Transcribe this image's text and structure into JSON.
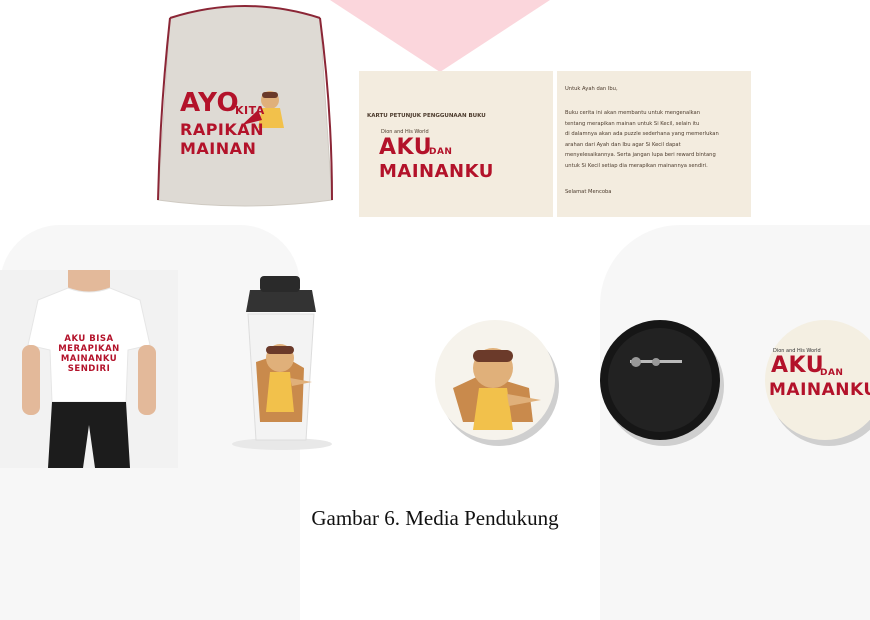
{
  "bag": {
    "line1": "AYO",
    "line1b": "KITA",
    "line2": "RAPIKAN MAINAN"
  },
  "card_left": {
    "heading": "KARTU PETUNJUK PENGGUNAAN BUKU",
    "series": "Dion and His World",
    "title1": "AKU",
    "title_dan": "DAN",
    "title2": "MAINANKU"
  },
  "card_right": {
    "greeting": "Untuk Ayah dan Ibu,",
    "body": [
      "Buku cerita ini akan membantu untuk mengenalkan",
      "tentang merapikan mainan untuk Si Kecil, selain itu",
      "di dalamnya akan ada puzzle sederhana yang memerlukan",
      "arahan dari Ayah dan Ibu agar Si Kecil dapat",
      "menyelesaikannya. Serta jangan lupa beri reward bintang",
      "untuk Si Kecil setiap dia merapikan mainannya sendiri."
    ],
    "closing": "Selamat Mencoba"
  },
  "tshirt": {
    "lines": [
      "AKU BISA",
      "MERAPIKAN",
      "MAINANKU",
      "SENDIRI"
    ]
  },
  "button": {
    "series": "Dion and His World",
    "title1": "AKU",
    "title_dan": "DAN",
    "title2": "MAINANKU"
  },
  "caption": "Gambar 6. Media Pendukung",
  "colors": {
    "brand_red": "#b3122a",
    "card_bg": "#f3ecdf",
    "bag_bg": "#dedad4"
  }
}
